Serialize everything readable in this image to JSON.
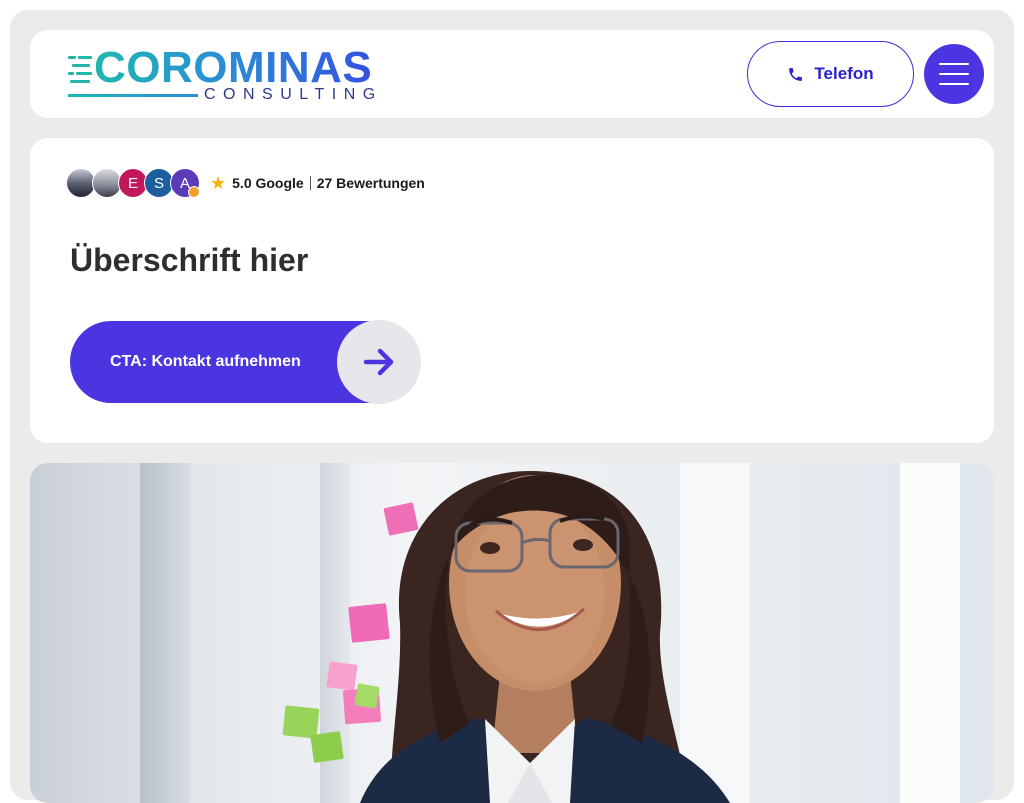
{
  "header": {
    "logo_main": "COROMINAS",
    "logo_sub": "CONSULTING",
    "phone_label": "Telefon"
  },
  "reviews": {
    "avatar_letters": [
      "E",
      "S",
      "A"
    ],
    "rating": "5.0 Google",
    "count": "27 Bewertungen"
  },
  "hero": {
    "heading": "Überschrift hier",
    "cta_label": "CTA: Kontakt aufnehmen"
  },
  "colors": {
    "accent": "#4b35e0",
    "star": "#f4b400"
  },
  "icons": [
    "phone-icon",
    "hamburger-menu-icon",
    "star-icon",
    "arrow-right-icon"
  ]
}
